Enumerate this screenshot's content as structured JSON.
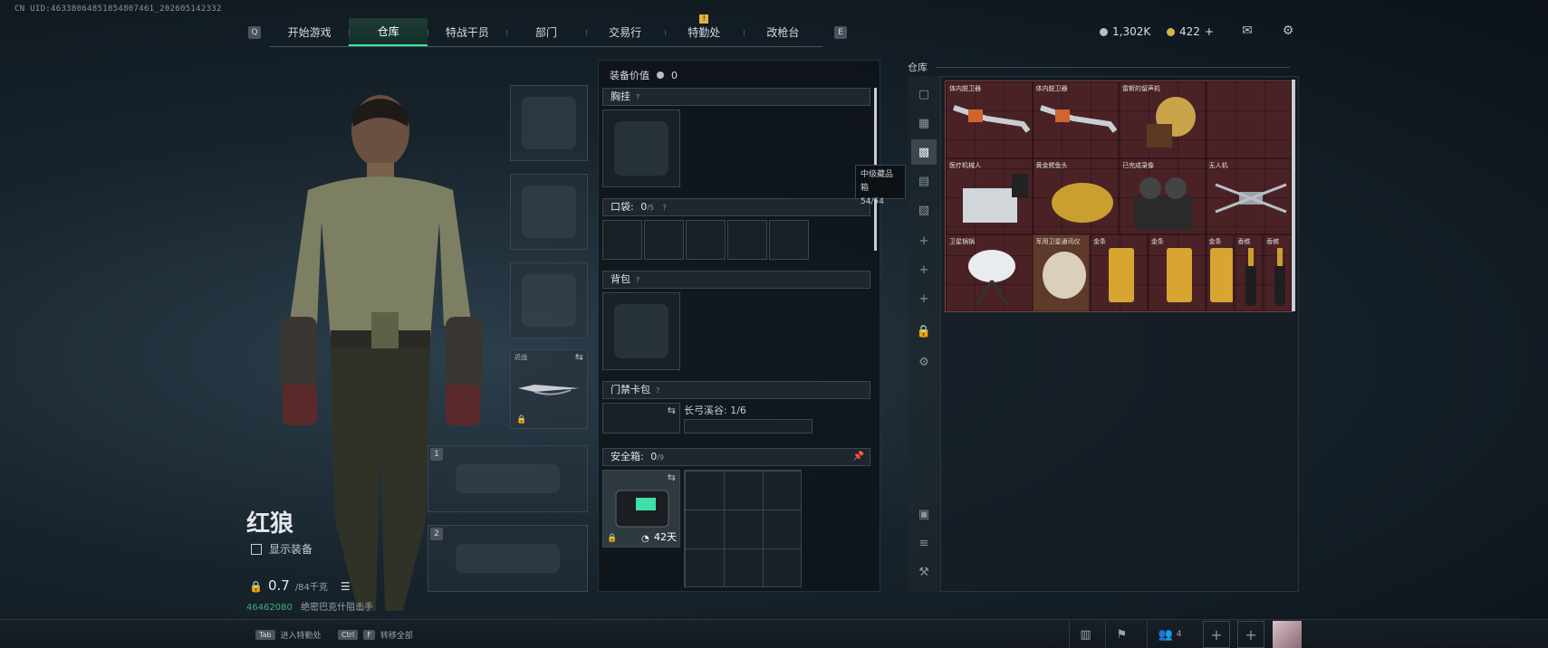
{
  "uid": "CN UID:4633806485185480746​1_202605142332",
  "nav": {
    "left_key": "Q",
    "right_key": "E",
    "tabs": [
      {
        "label": "开始游戏",
        "active": false
      },
      {
        "label": "仓库",
        "active": true
      },
      {
        "label": "特战干员",
        "active": false
      },
      {
        "label": "部门",
        "active": false
      },
      {
        "label": "交易行",
        "active": false
      },
      {
        "label": "特勤处",
        "active": false,
        "badge": "!"
      },
      {
        "label": "改枪台",
        "active": false
      }
    ]
  },
  "currency": {
    "silver": "1,302K",
    "gold": "422",
    "gold_add": "+"
  },
  "character": {
    "name": "红狼",
    "show_equip_label": "显示装备",
    "weight_value": "0.7",
    "weight_max": "/84千克",
    "footnote_id": "46462080",
    "footnote_text": "绝密巴克什阻击手"
  },
  "equipment": {
    "value_label": "装备价值",
    "value": "0",
    "sections": {
      "chest": {
        "title": "胸挂",
        "help": "?"
      },
      "pockets": {
        "title": "口袋:",
        "count": "0",
        "max": "/5",
        "help": "?"
      },
      "backpack": {
        "title": "背包",
        "help": "?"
      },
      "keycard": {
        "title": "门禁卡包",
        "help": "?",
        "detail": "长弓溪谷: 1/6"
      },
      "safebox": {
        "title": "安全箱:",
        "count": "0",
        "max": "/9",
        "days": "42天"
      }
    }
  },
  "melee_label": "近战",
  "slot_numbers": [
    "1",
    "2"
  ],
  "tooltip": {
    "title": "中级藏品箱",
    "count": "54/54"
  },
  "warehouse": {
    "title": "仓库",
    "items": [
      {
        "name": "体内脱卫器",
        "color": "#5a2a2e"
      },
      {
        "name": "体内脱卫器",
        "color": "#5a2a2e"
      },
      {
        "name": "雷斯的留声机",
        "color": "#5a2a2e"
      },
      {
        "name": "医疗机械人",
        "color": "#5a2a2e"
      },
      {
        "name": "黄金鳄鱼头",
        "color": "#5a2a2e"
      },
      {
        "name": "已完成录像",
        "color": "#5a2a2e"
      },
      {
        "name": "无人机",
        "color": "#5a2a2e"
      },
      {
        "name": "卫星锅锅",
        "color": "#5a2a2e"
      },
      {
        "name": "军用卫星通讯仪",
        "color": "#6a3a30"
      },
      {
        "name": "金条",
        "color": "#5a2a2e"
      },
      {
        "name": "金条",
        "color": "#5a2a2e"
      },
      {
        "name": "金条",
        "color": "#5a2a2e"
      },
      {
        "name": "香槟",
        "color": "#5a2a2e"
      },
      {
        "name": "香槟",
        "color": "#5a2a2e"
      }
    ]
  },
  "bottom": {
    "hotkeys": [
      {
        "key": "Tab",
        "label": "进入特勤处"
      },
      {
        "key": "Ctrl",
        "key2": "F",
        "label": "转移全部"
      }
    ],
    "friends_count": "4"
  }
}
